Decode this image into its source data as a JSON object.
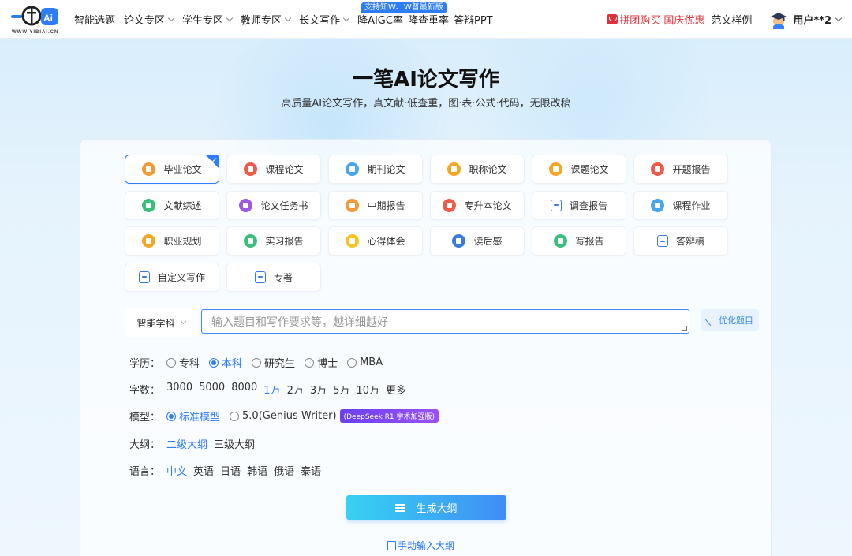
{
  "header": {
    "logo_sub": "WWW.YIBIAI.CN",
    "nav": [
      "智能选题",
      "论文专区",
      "学生专区",
      "教师专区",
      "长文写作",
      "降AIGC率",
      "降查重率",
      "答辩PPT"
    ],
    "nav_badge": "支持知W、W普最新版",
    "promo": "拼团购买 国庆优惠",
    "sample": "范文样例",
    "user": "用户**2"
  },
  "hero": {
    "title": "一笔AI论文写作",
    "subtitle": "高质量AI论文写作，真文献·低查重，图·表·公式·代码，无限改稿"
  },
  "types": [
    {
      "label": "毕业论文",
      "icon": "graduation-icon",
      "color": "#f29a3a"
    },
    {
      "label": "课程论文",
      "icon": "book-icon",
      "color": "#ef5a4a"
    },
    {
      "label": "期刊论文",
      "icon": "journal-icon",
      "color": "#49a6ee"
    },
    {
      "label": "职称论文",
      "icon": "certificate-icon",
      "color": "#f5a623"
    },
    {
      "label": "课题论文",
      "icon": "topic-icon",
      "color": "#f5a623"
    },
    {
      "label": "开题报告",
      "icon": "report-icon",
      "color": "#ef5a4a"
    },
    {
      "label": "文献综述",
      "icon": "literature-icon",
      "color": "#3cbf7a"
    },
    {
      "label": "论文任务书",
      "icon": "task-icon",
      "color": "#9b59e6"
    },
    {
      "label": "中期报告",
      "icon": "midterm-icon",
      "color": "#f29a3a"
    },
    {
      "label": "专升本论文",
      "icon": "upgrade-icon",
      "color": "#ef5a4a"
    },
    {
      "label": "调查报告",
      "icon": "survey-icon",
      "color": "outline"
    },
    {
      "label": "课程作业",
      "icon": "homework-icon",
      "color": "#49a6ee"
    },
    {
      "label": "职业规划",
      "icon": "career-icon",
      "color": "#f5a623"
    },
    {
      "label": "实习报告",
      "icon": "internship-icon",
      "color": "#3cbf7a"
    },
    {
      "label": "心得体会",
      "icon": "reflection-icon",
      "color": "#f5c423"
    },
    {
      "label": "读后感",
      "icon": "chat-icon",
      "color": "#3a7be0"
    },
    {
      "label": "写报告",
      "icon": "write-icon",
      "color": "#3cbf7a"
    },
    {
      "label": "答辩稿",
      "icon": "defense-icon",
      "color": "outline"
    },
    {
      "label": "自定义写作",
      "icon": "sliders-icon",
      "color": "outline"
    },
    {
      "label": "专著",
      "icon": "open-book-icon",
      "color": "outline"
    }
  ],
  "subject": "智能学科",
  "prompt_placeholder": "输入题目和写作要求等，越详细越好",
  "optimize_label": "优化题目",
  "education": {
    "label": "学历：",
    "options": [
      "专科",
      "本科",
      "研究生",
      "博士",
      "MBA"
    ],
    "selected": "本科"
  },
  "words": {
    "label": "字数：",
    "options": [
      "3000",
      "5000",
      "8000",
      "1万",
      "2万",
      "3万",
      "5万",
      "10万",
      "更多"
    ],
    "selected": "1万"
  },
  "model": {
    "label": "模型：",
    "options": [
      "标准模型",
      "5.0(Genius Writer)"
    ],
    "selected": "标准模型",
    "badge": "(DeepSeek R1 学术加强版)"
  },
  "outline": {
    "label": "大纲：",
    "options": [
      "二级大纲",
      "三级大纲"
    ],
    "selected": "二级大纲"
  },
  "language": {
    "label": "语言：",
    "options": [
      "中文",
      "英语",
      "日语",
      "韩语",
      "俄语",
      "泰语"
    ],
    "selected": "中文"
  },
  "generate_label": "生成大纲",
  "manual_label": "手动输入大纲"
}
